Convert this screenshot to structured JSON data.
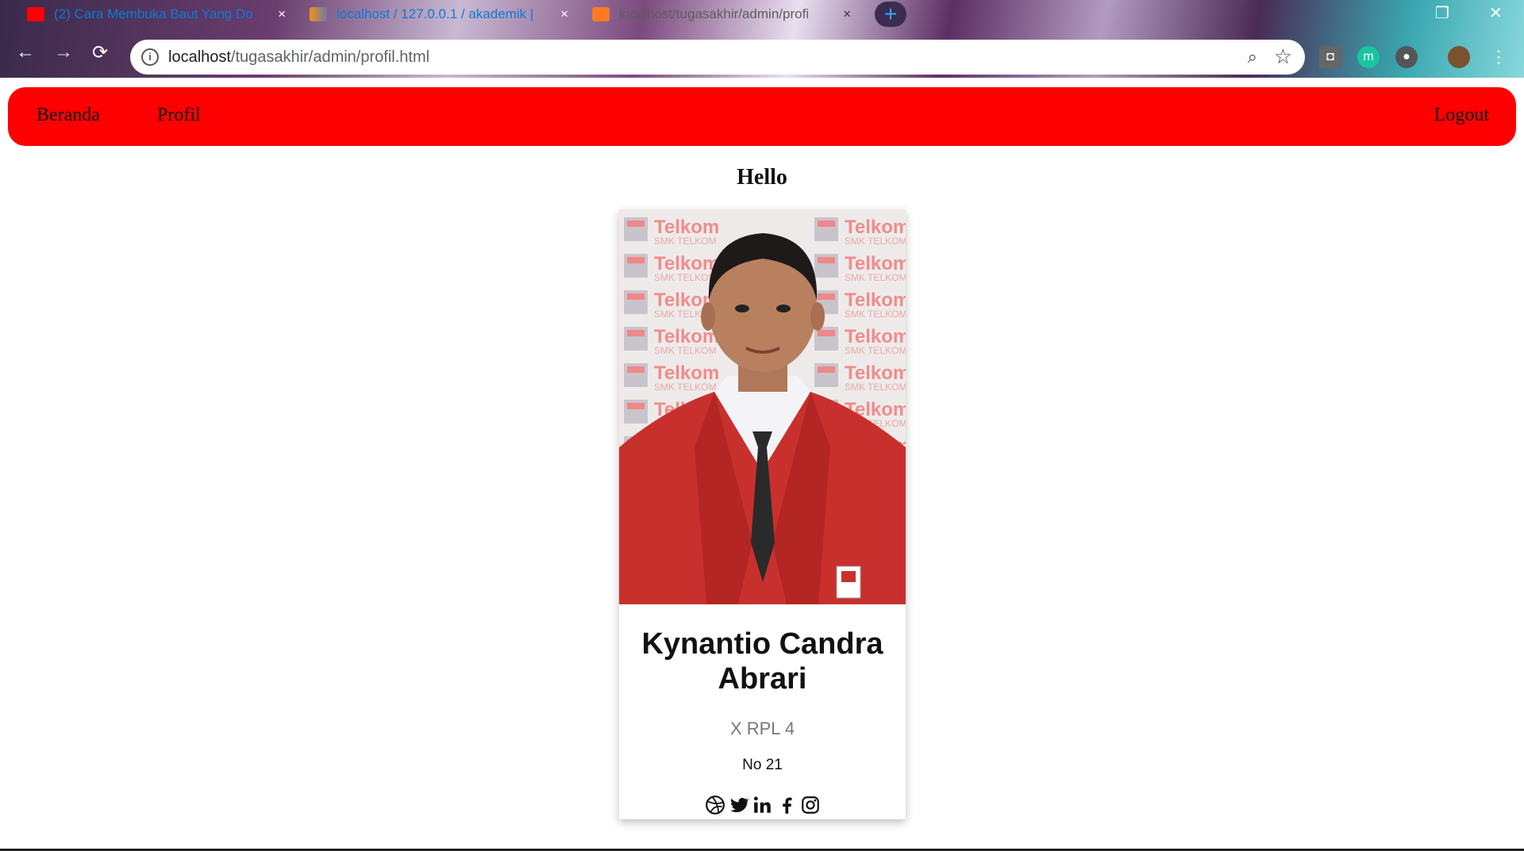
{
  "browser": {
    "tabs": [
      {
        "title": "(2) Cara Membuka Baut Yang Do",
        "favicon": "youtube-icon"
      },
      {
        "title": "localhost / 127.0.0.1 / akademik |",
        "favicon": "phpmyadmin-icon"
      },
      {
        "title": "localhost/tugasakhir/admin/profi",
        "favicon": "xampp-icon"
      }
    ],
    "close_glyph": "×",
    "new_tab_glyph": "+",
    "url_host": "localhost",
    "url_path": "/tugasakhir/admin/profil.html"
  },
  "nav": {
    "home_label": "Beranda",
    "profile_label": "Profil",
    "logout_label": "Logout"
  },
  "greeting": "Hello",
  "profile": {
    "name": "Kynantio Candra Abrari",
    "class": "X RPL 4",
    "number": "No 21",
    "photo_backdrop_text": "Telkom",
    "photo_backdrop_sub": "SMK TELKOM MALANG",
    "social_icons": [
      "dribbble-icon",
      "twitter-icon",
      "linkedin-icon",
      "facebook-icon",
      "instagram-icon"
    ]
  },
  "colors": {
    "navbar": "#ff0000",
    "blazer": "#c8302e"
  }
}
